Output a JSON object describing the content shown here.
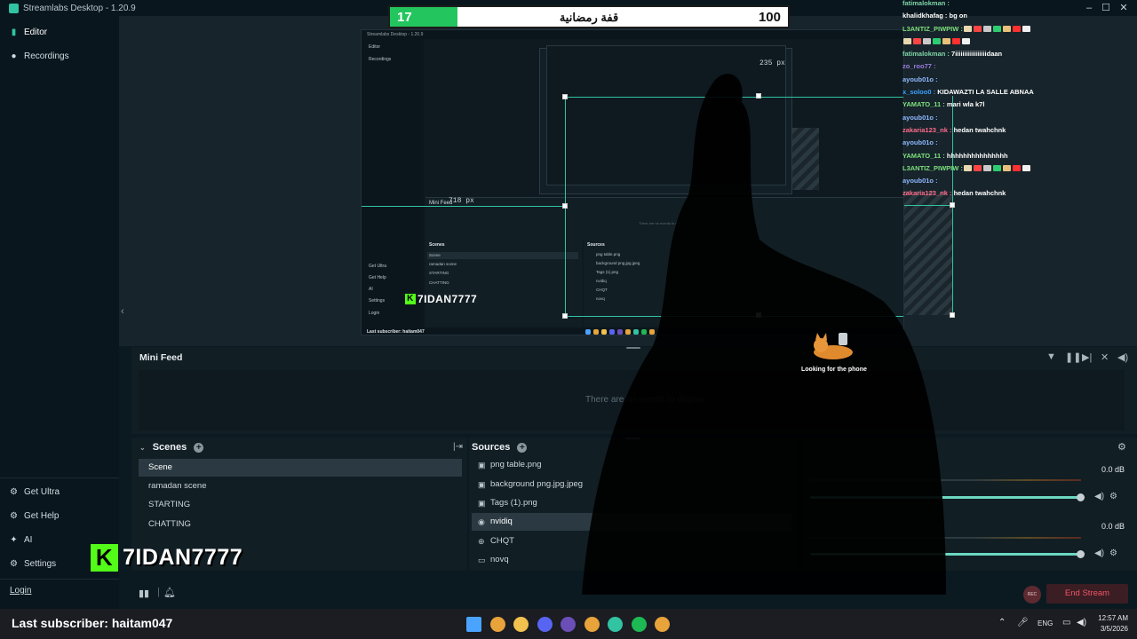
{
  "window": {
    "title": "Streamlabs Desktop - 1.20.9"
  },
  "nav": {
    "editor": "Editor",
    "recordings": "Recordings",
    "get_ultra": "Get Ultra",
    "get_help": "Get Help",
    "ai": "AI",
    "settings": "Settings",
    "login": "Login"
  },
  "goal_bar": {
    "current": "17",
    "target": "100",
    "title": "قفة رمضانية",
    "progress": 0.17,
    "fill_color": "#22c55e"
  },
  "preview": {
    "window_title": "Streamlabs Desktop - 1.20.9",
    "nav_editor": "Editor",
    "nav_recordings": "Recordings",
    "nav_get_ultra": "Get Ultra",
    "nav_get_help": "Get Help",
    "nav_ai": "AI",
    "nav_settings": "Settings",
    "nav_login": "Login",
    "mini_feed": "Mini Feed",
    "empty_feed": "There are no events to display",
    "scenes_title": "Scenes",
    "sources_title": "Sources",
    "scenes": [
      "Scene",
      "ramadan scene",
      "STARTING",
      "CHATTING"
    ],
    "sources": [
      "png table.png",
      "background png.jpg.jpeg",
      "Tags (1).png",
      "nvidiq",
      "CHQT",
      "novq"
    ],
    "subscriber": "Last subscriber: haitam047",
    "watermark": "7IDAN7777",
    "px_label_1": "718 px",
    "px_label_2": "235 px",
    "cat_caption": "Looking for the phone"
  },
  "chat": [
    {
      "user": "fatimalokman :",
      "msg": "",
      "color": "#7fd4a8"
    },
    {
      "user": "khalidkhafag :",
      "msg": "bg on",
      "color": "#ffffff"
    },
    {
      "user": "L3ANTIZ_PIWPIW :",
      "msg": "",
      "color": "#7ee07e",
      "emotes": true
    },
    {
      "user": "",
      "msg": "",
      "color": "#ffffff",
      "emotes": true
    },
    {
      "user": "fatimalokman :",
      "msg": "7iiiiiiiiiiiiiiiiidaan",
      "color": "#7fd4a8"
    },
    {
      "user": "zo_roo77 :",
      "msg": "",
      "color": "#9b7fe0"
    },
    {
      "user": "ayoub01o :",
      "msg": "",
      "color": "#8fb8ff"
    },
    {
      "user": "x_soloo0 :",
      "msg": "KIDAWAZTI LA SALLE ABNAA",
      "color": "#3aa0ff"
    },
    {
      "user": "YAMATO_11 :",
      "msg": "mari wla k7l",
      "color": "#7ee07e"
    },
    {
      "user": "ayoub01o :",
      "msg": "",
      "color": "#8fb8ff"
    },
    {
      "user": "zakaria123_nk :",
      "msg": "hedan twahchnk",
      "color": "#ff6b8a"
    },
    {
      "user": "ayoub01o :",
      "msg": "",
      "color": "#8fb8ff"
    },
    {
      "user": "YAMATO_11 :",
      "msg": "hhhhhhhhhhhhhhh",
      "color": "#7ee07e"
    },
    {
      "user": "L3ANTIZ_PIWPIW :",
      "msg": "",
      "color": "#7ee07e",
      "emotes": true
    },
    {
      "user": "ayoub01o :",
      "msg": "",
      "color": "#8fb8ff"
    },
    {
      "user": "zakaria123_nk :",
      "msg": "hedan twahchnk",
      "color": "#ff6b8a"
    }
  ],
  "mini_feed": {
    "title": "Mini Feed",
    "empty": "There are no events to display"
  },
  "scenes": {
    "title": "Scenes",
    "items": [
      "Scene",
      "ramadan scene",
      "STARTING",
      "CHATTING"
    ],
    "selected": 0
  },
  "sources": {
    "title": "Sources",
    "items": [
      {
        "name": "png table.png",
        "icon": "image-icon"
      },
      {
        "name": "background png.jpg.jpeg",
        "icon": "image-icon"
      },
      {
        "name": "Tags (1).png",
        "icon": "image-icon"
      },
      {
        "name": "nvidiq",
        "icon": "webcam-icon"
      },
      {
        "name": "CHQT",
        "icon": "browser-source-icon"
      },
      {
        "name": "novq",
        "icon": "display-capture-icon"
      }
    ],
    "selected": 3
  },
  "mixer": {
    "channels": [
      {
        "db": "0.0 dB",
        "level": 1.0
      },
      {
        "db": "0.0 dB",
        "level": 1.0
      }
    ]
  },
  "footer": {
    "rec_label": "REC",
    "end_stream": "End Stream"
  },
  "overlay": {
    "watermark": "7IDAN7777",
    "watermark_logo": "K",
    "last_subscriber": "Last subscriber: haitam047",
    "cat_caption": "Looking for the phone"
  },
  "taskbar": {
    "lang": "ENG",
    "time": "12:57 AM",
    "date": "3/5/2026",
    "icons": [
      {
        "name": "windows-start-icon",
        "color": "#4aa3ff"
      },
      {
        "name": "chrome-icon",
        "color": "#e8a33a"
      },
      {
        "name": "file-explorer-icon",
        "color": "#f2c14e"
      },
      {
        "name": "discord-icon",
        "color": "#5865f2"
      },
      {
        "name": "obs-icon",
        "color": "#6b4fb8"
      },
      {
        "name": "chrome-icon-2",
        "color": "#e8a33a"
      },
      {
        "name": "streamlabs-icon",
        "color": "#31c3a2"
      },
      {
        "name": "spotify-icon",
        "color": "#1db954"
      },
      {
        "name": "chrome-icon-3",
        "color": "#e8a33a"
      }
    ]
  }
}
